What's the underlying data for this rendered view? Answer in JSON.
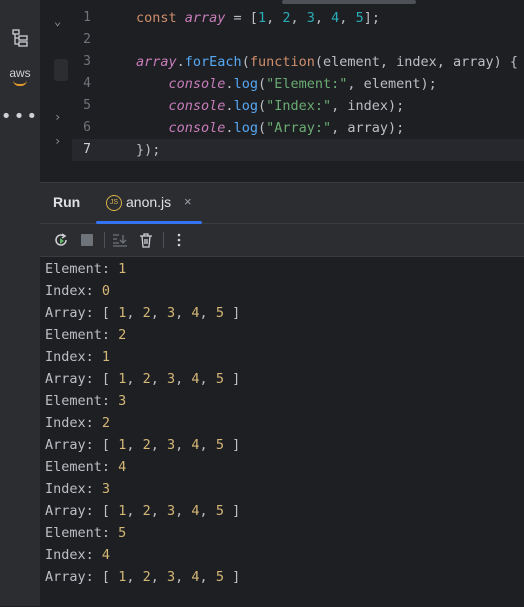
{
  "editor": {
    "lines": [
      {
        "num": "1",
        "tokens": [
          [
            "kw",
            "const "
          ],
          [
            "var",
            "array"
          ],
          [
            "plain",
            " = ["
          ],
          [
            "num",
            "1"
          ],
          [
            "plain",
            ", "
          ],
          [
            "num",
            "2"
          ],
          [
            "plain",
            ", "
          ],
          [
            "num",
            "3"
          ],
          [
            "plain",
            ", "
          ],
          [
            "num",
            "4"
          ],
          [
            "plain",
            ", "
          ],
          [
            "num",
            "5"
          ],
          [
            "plain",
            "];"
          ]
        ]
      },
      {
        "num": "2",
        "tokens": []
      },
      {
        "num": "3",
        "tokens": [
          [
            "obj",
            "array"
          ],
          [
            "plain",
            "."
          ],
          [
            "fn",
            "forEach"
          ],
          [
            "plain",
            "("
          ],
          [
            "kw",
            "function"
          ],
          [
            "plain",
            "(element, index, array) {"
          ]
        ]
      },
      {
        "num": "4",
        "tokens": [
          [
            "plain",
            "    "
          ],
          [
            "obj",
            "console"
          ],
          [
            "plain",
            "."
          ],
          [
            "fn",
            "log"
          ],
          [
            "plain",
            "("
          ],
          [
            "str",
            "\"Element:\""
          ],
          [
            "plain",
            ", element);"
          ]
        ]
      },
      {
        "num": "5",
        "tokens": [
          [
            "plain",
            "    "
          ],
          [
            "obj",
            "console"
          ],
          [
            "plain",
            "."
          ],
          [
            "fn",
            "log"
          ],
          [
            "plain",
            "("
          ],
          [
            "str",
            "\"Index:\""
          ],
          [
            "plain",
            ", index);"
          ]
        ]
      },
      {
        "num": "6",
        "tokens": [
          [
            "plain",
            "    "
          ],
          [
            "obj",
            "console"
          ],
          [
            "plain",
            "."
          ],
          [
            "fn",
            "log"
          ],
          [
            "plain",
            "("
          ],
          [
            "str",
            "\"Array:\""
          ],
          [
            "plain",
            ", array);"
          ]
        ]
      },
      {
        "num": "7",
        "tokens": [
          [
            "plain",
            "});"
          ]
        ]
      }
    ],
    "current_line": 7
  },
  "run_panel": {
    "title": "Run",
    "tab": {
      "icon": "js-file-icon",
      "icon_text": "JS",
      "name": "anon.js",
      "close": "×"
    },
    "toolbar": [
      "rerun-icon",
      "stop-icon",
      "scroll-to-end-icon",
      "clear-all-icon",
      "more-options-icon"
    ]
  },
  "console": [
    {
      "label": "Element:",
      "value": "1"
    },
    {
      "label": "Index:",
      "value": "0"
    },
    {
      "label": "Array:",
      "array": [
        "1",
        "2",
        "3",
        "4",
        "5"
      ]
    },
    {
      "label": "Element:",
      "value": "2"
    },
    {
      "label": "Index:",
      "value": "1"
    },
    {
      "label": "Array:",
      "array": [
        "1",
        "2",
        "3",
        "4",
        "5"
      ]
    },
    {
      "label": "Element:",
      "value": "3"
    },
    {
      "label": "Index:",
      "value": "2"
    },
    {
      "label": "Array:",
      "array": [
        "1",
        "2",
        "3",
        "4",
        "5"
      ]
    },
    {
      "label": "Element:",
      "value": "4"
    },
    {
      "label": "Index:",
      "value": "3"
    },
    {
      "label": "Array:",
      "array": [
        "1",
        "2",
        "3",
        "4",
        "5"
      ]
    },
    {
      "label": "Element:",
      "value": "5"
    },
    {
      "label": "Index:",
      "value": "4"
    },
    {
      "label": "Array:",
      "array": [
        "1",
        "2",
        "3",
        "4",
        "5"
      ]
    }
  ],
  "sidebar": {
    "icons": [
      "structure-icon",
      "aws-icon",
      "more-icon"
    ],
    "aws_label": "aws",
    "more_label": "•••"
  }
}
